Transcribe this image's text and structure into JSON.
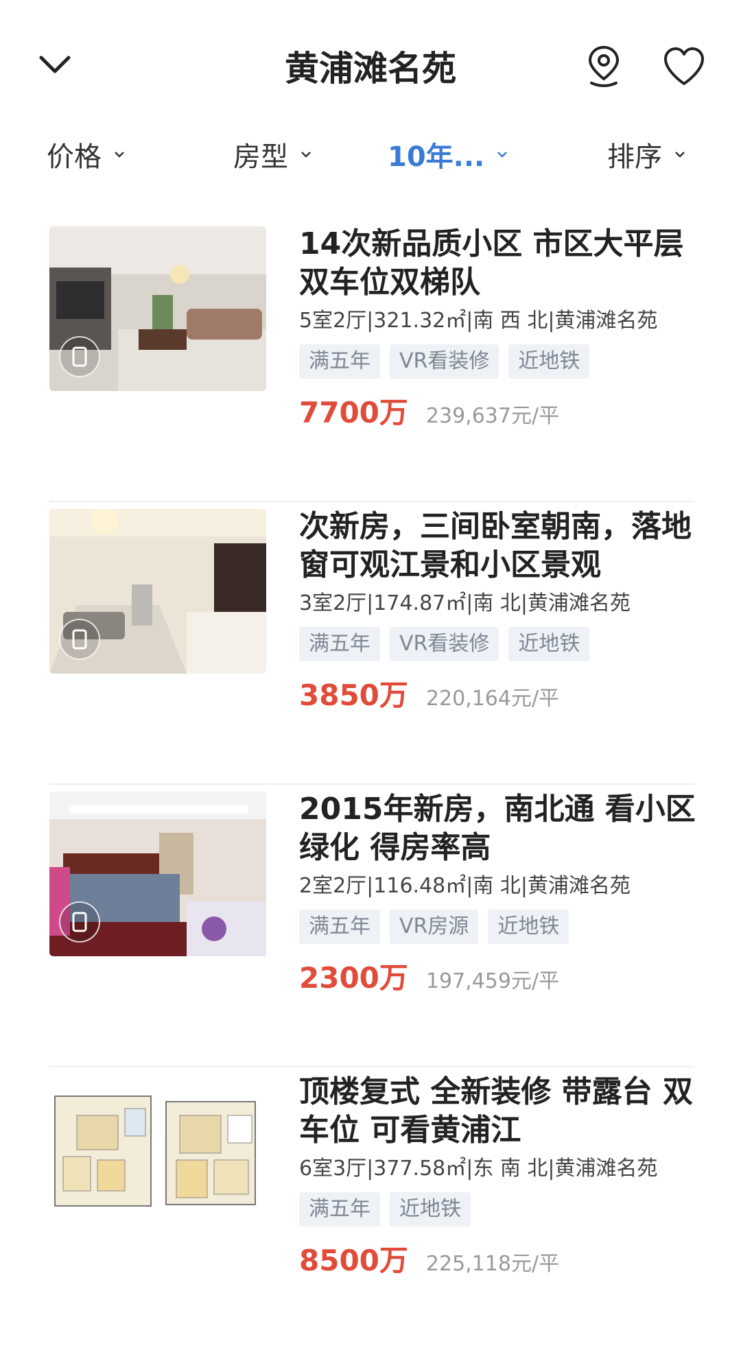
{
  "header": {
    "title": "黄浦滩名苑",
    "back_icon": "chevron-down-icon",
    "location_icon": "map-pin-icon",
    "favorite_icon": "heart-icon"
  },
  "filters": [
    {
      "label": "价格",
      "active": false
    },
    {
      "label": "房型",
      "active": false
    },
    {
      "label": "10年...",
      "active": true
    },
    {
      "label": "排序",
      "active": false
    }
  ],
  "colors": {
    "accent": "#3a7bd5",
    "price": "#e04b3a",
    "tag_bg": "#eef1f5",
    "tag_text": "#7d8896"
  },
  "listings": [
    {
      "title": "14次新品质小区 市区大平层 双车位双梯队",
      "meta": "5室2厅|321.32㎡|南 西 北|黄浦滩名苑",
      "tags": [
        "满五年",
        "VR看装修",
        "近地铁"
      ],
      "price": "7700万",
      "unit_price": "239,637元/平",
      "image": "living-room-photo",
      "vr_badge": true
    },
    {
      "title": "次新房，三间卧室朝南，落地窗可观江景和小区景观",
      "meta": "3室2厅|174.87㎡|南 北|黄浦滩名苑",
      "tags": [
        "满五年",
        "VR看装修",
        "近地铁"
      ],
      "price": "3850万",
      "unit_price": "220,164元/平",
      "image": "living-room-tv-photo",
      "vr_badge": true
    },
    {
      "title": "2015年新房，南北通 看小区绿化 得房率高",
      "meta": "2室2厅|116.48㎡|南 北|黄浦滩名苑",
      "tags": [
        "满五年",
        "VR房源",
        "近地铁"
      ],
      "price": "2300万",
      "unit_price": "197,459元/平",
      "image": "bedroom-photo",
      "vr_badge": true
    },
    {
      "title": "顶楼复式 全新装修 带露台 双车位 可看黄浦江",
      "meta": "6室3厅|377.58㎡|东 南 北|黄浦滩名苑",
      "tags": [
        "满五年",
        "近地铁"
      ],
      "price": "8500万",
      "unit_price": "225,118元/平",
      "image": "floor-plan-image",
      "vr_badge": false
    }
  ]
}
